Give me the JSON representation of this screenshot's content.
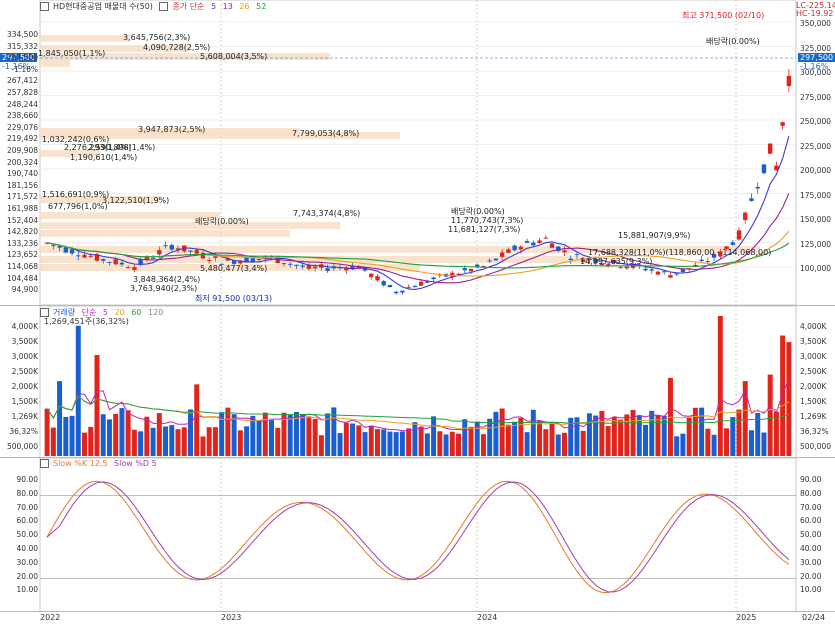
{
  "price_pane": {
    "title_box": "HD현대중공업 매물대 수(50)",
    "ma_label": "종가 단순",
    "ma_periods": [
      "5",
      "13",
      "26",
      "52"
    ],
    "ma_colors": [
      "#3a3ad8",
      "#a02090",
      "#e8a020",
      "#20a040"
    ],
    "top_right": [
      "LC-225.14",
      "HC-19.92"
    ],
    "current_price": "297,500",
    "current_change": "-1.16%",
    "left_ticks": [
      "334,500",
      "315,332",
      "297,500",
      "-1.16%",
      "267,412",
      "257,828",
      "248,244",
      "238,660",
      "229,076",
      "219,492",
      "209,908",
      "200,324",
      "190,740",
      "181,156",
      "171,572",
      "161,988",
      "152,404",
      "142,820",
      "133,236",
      "123,652",
      "114,068",
      "104,484",
      "94,900"
    ],
    "right_ticks": [
      "350,000",
      "325,000",
      "300,000",
      "275,000",
      "250,000",
      "225,000",
      "200,000",
      "175,000",
      "150,000",
      "125,000",
      "100,000"
    ],
    "volume_profile_labels": [
      "3,645,756(2,3%)",
      "4,090,728(2,5%)",
      "5,608,004(3,5%)",
      "1,845,050(1,1%)",
      "3,947,873(2,5%)",
      "7,799,053(4,8%)",
      "1,032,242(0,6%)",
      "2,276,293(1,4%)",
      "2,590,898(1,4%)",
      "1,190,610(1,4%)",
      "7,743,374(4,8%)",
      "11,770,743(7,3%)",
      "11,681,127(7,3%)",
      "17,688,328(11,0%)(118,860,00 - 114,068,00)",
      "14,997,635(9,3%)",
      "15,881,907(9,9%)",
      "3,848,364(2,4%)",
      "3,763,940(2,3%)",
      "5,480,477(3,4%)",
      "677,796(1,0%)",
      "3,122,510(1,9%)",
      "1,516,691(0,9%)"
    ],
    "annotations": {
      "high": "최고 371,500 (02/10)",
      "low": "최저 91,500 (03/13)",
      "ex_dividend": "배당락(0.00%)"
    }
  },
  "volume_pane": {
    "label": "거래량",
    "ma_label": "단순",
    "ma_periods": [
      "5",
      "20",
      "60",
      "120"
    ],
    "ma_colors": [
      "#c020c0",
      "#e8a020",
      "#20a040",
      "#888888"
    ],
    "current_volume": "1,269,451주(36,32%)",
    "left_ticks": [
      "4,000K",
      "3,500K",
      "3,000K",
      "2,500K",
      "2,000K",
      "1,500K",
      "1,269K",
      "36,32%",
      "500,000"
    ],
    "right_ticks": [
      "4,000K",
      "3,500K",
      "3,000K",
      "2,500K",
      "2,000K",
      "1,500K",
      "1,269K",
      "36,32%",
      "500,000"
    ]
  },
  "stoch_pane": {
    "label_k": "Slow %K 12,5",
    "label_d": "Slow %D 5",
    "k_color": "#e8782a",
    "d_color": "#9a40b0",
    "ticks": [
      "90.00",
      "80.00",
      "70.00",
      "60.00",
      "50.00",
      "40.00",
      "30.00",
      "20.00",
      "10.00"
    ]
  },
  "x_axis": {
    "labels": [
      "2022",
      "2023",
      "2024",
      "2025"
    ],
    "end_label": "02/24"
  },
  "colors": {
    "up": "#e0241b",
    "down": "#1a5fd0",
    "profile": "#f7dfc6",
    "current": "#1769c9"
  }
}
